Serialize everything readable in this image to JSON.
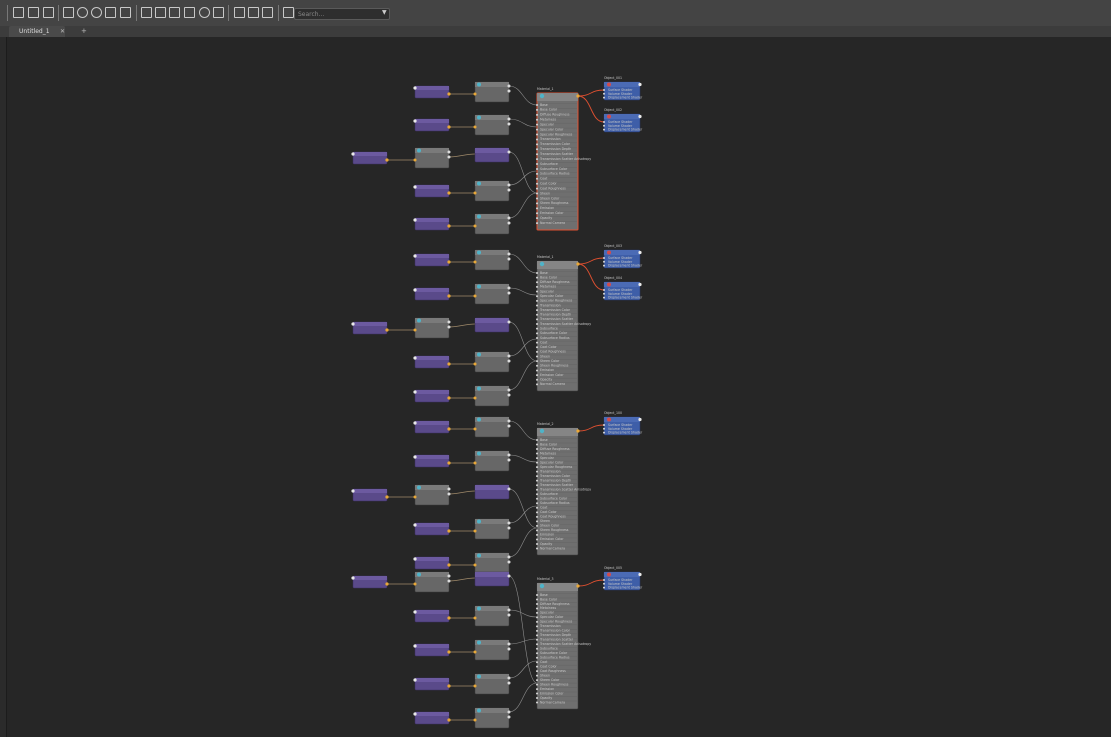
{
  "tab": {
    "label": "Untitled_1",
    "close": "✕",
    "add": "+"
  },
  "search": {
    "placeholder": "Search..."
  },
  "toolbar_icons": [
    "graph-icon",
    "frame-icon",
    "input-output-icon",
    "select-icon",
    "connections-icon",
    "clear-icon",
    "arrange-icon",
    "remove-icon",
    "layout-icon",
    "list-icon",
    "grid-icon",
    "table-icon",
    "zoom-icon",
    "pin-icon",
    "snap-icon",
    "swatch-icon",
    "render-icon",
    "tab-icon"
  ],
  "colors": {
    "file_node": "#5a4a8a",
    "utility_node": "#676767",
    "material_node": "#6f6f6f",
    "shading_node": "#3e5ea8",
    "selected": "#e05030",
    "wire": "#a08a6a"
  },
  "material_attrs": [
    "Base",
    "Base Color",
    "Diffuse Roughness",
    "Metalness",
    "Specular",
    "Specular Color",
    "Specular Roughness",
    "Transmission",
    "Transmission Color",
    "Transmission Depth",
    "Transmission Scatter",
    "Transmission Scatter Anisotropy",
    "Subsurface",
    "Subsurface Color",
    "Subsurface Radius",
    "Coat",
    "Coat Color",
    "Coat Roughness",
    "Sheen",
    "Sheen Color",
    "Sheen Roughness",
    "Emission",
    "Emission Color",
    "Opacity",
    "Normal Camera"
  ],
  "shading_attrs": [
    "Surface Shader",
    "Volume Shader",
    "Displacement Shader"
  ],
  "groups": [
    {
      "material": "Material_1",
      "shading": [
        "Object_001",
        "Object_002"
      ],
      "file_nodes": 5
    },
    {
      "material": "Material_1",
      "shading": [
        "Object_003",
        "Object_004"
      ],
      "file_nodes": 5
    },
    {
      "material": "Material_2",
      "shading": [
        "Object_100"
      ],
      "file_nodes": 5
    },
    {
      "material": "Material_3",
      "shading": [
        "Object_005"
      ],
      "file_nodes": 5
    }
  ]
}
